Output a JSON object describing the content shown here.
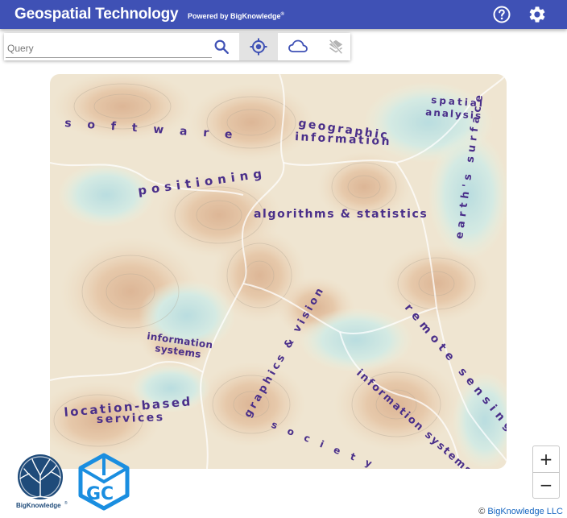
{
  "header": {
    "title": "Geospatial Technology",
    "powered_by": "Powered by BigKnowledge",
    "powered_mark": "®",
    "help_icon": "help-circle-icon",
    "settings_icon": "gear-icon",
    "bg_color": "#3f51b5"
  },
  "toolbar": {
    "query_placeholder": "Query",
    "query_value": "",
    "search_icon": "search-icon",
    "locate_icon": "crosshair-icon",
    "cloud_icon": "cloud-icon",
    "layers_off_icon": "layers-off-icon"
  },
  "map": {
    "labels": [
      "s o f t w a r e",
      "geographic",
      "information",
      "spatial",
      "analysis",
      "algorithms & statistics",
      "earth's surface",
      "positioning",
      "information",
      "systems",
      "graphics & vision",
      "remote sensing",
      "location-based",
      "services",
      "s o c i e t y",
      "information systems"
    ]
  },
  "zoom": {
    "in_label": "+",
    "out_label": "−"
  },
  "logos": {
    "bk_name": "BigKnowledge",
    "bk_mark": "®",
    "gc_letters": "GC"
  },
  "footer": {
    "copyright": "©",
    "company": "BigKnowledge LLC"
  }
}
